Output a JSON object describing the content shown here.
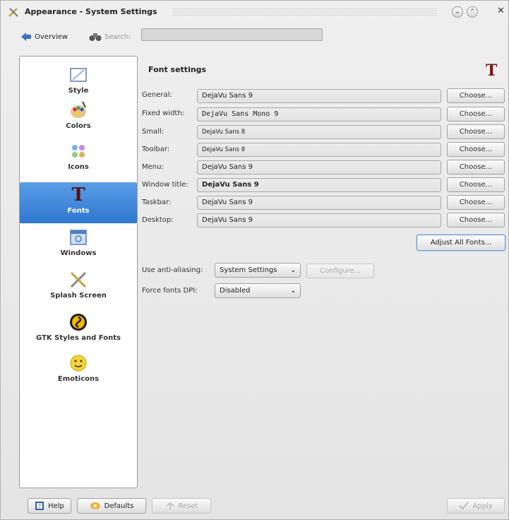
{
  "window": {
    "title": "Appearance - System Settings"
  },
  "toolbar": {
    "overview_label": "Overview",
    "search_label": "Search:",
    "search_value": ""
  },
  "sidebar": {
    "items": [
      {
        "label": "Style",
        "icon": "style-icon"
      },
      {
        "label": "Colors",
        "icon": "colors-icon"
      },
      {
        "label": "Icons",
        "icon": "icons-icon"
      },
      {
        "label": "Fonts",
        "icon": "fonts-icon",
        "selected": true
      },
      {
        "label": "Windows",
        "icon": "windows-icon"
      },
      {
        "label": "Splash Screen",
        "icon": "splash-screen-icon"
      },
      {
        "label": "GTK Styles and Fonts",
        "icon": "gtk-icon"
      },
      {
        "label": "Emoticons",
        "icon": "emoticons-icon"
      }
    ]
  },
  "font_settings": {
    "title": "Font settings",
    "choose_label": "Choose...",
    "rows": [
      {
        "label": "General:",
        "value": "DejaVu Sans 9"
      },
      {
        "label": "Fixed width:",
        "value": "DejaVu Sans Mono 9"
      },
      {
        "label": "Small:",
        "value": "DejaVu Sans 8"
      },
      {
        "label": "Toolbar:",
        "value": "DejaVu Sans 8"
      },
      {
        "label": "Menu:",
        "value": "DejaVu Sans 9"
      },
      {
        "label": "Window title:",
        "value": "DejaVu Sans 9"
      },
      {
        "label": "Taskbar:",
        "value": "DejaVu Sans 9"
      },
      {
        "label": "Desktop:",
        "value": "DejaVu Sans 9"
      }
    ],
    "adjust_all_label": "Adjust All Fonts..."
  },
  "options": {
    "anti_aliasing_label": "Use anti-aliasing:",
    "anti_aliasing_value": "System Settings",
    "configure_label": "Configure...",
    "force_dpi_label": "Force fonts DPI:",
    "force_dpi_value": "Disabled"
  },
  "bottom": {
    "help_label": "Help",
    "defaults_label": "Defaults",
    "reset_label": "Reset",
    "apply_label": "Apply"
  },
  "colors": {
    "selection": "#2e78d0",
    "fonts_icon": "#7a1414"
  }
}
